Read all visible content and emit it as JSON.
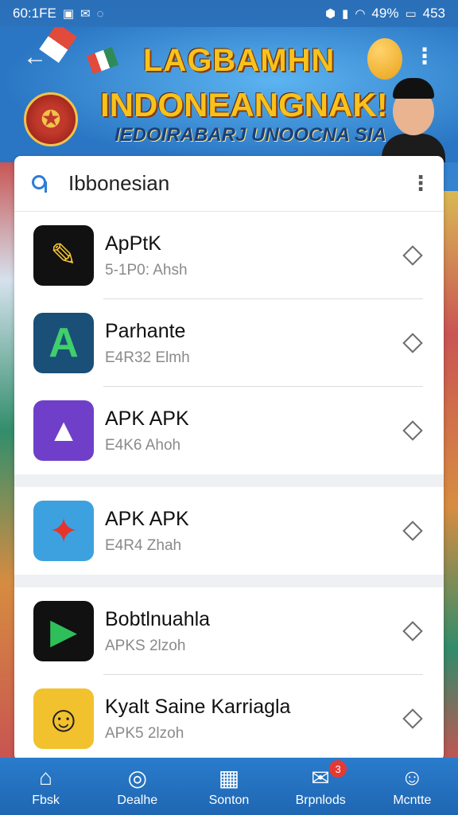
{
  "status_bar": {
    "time": "60:1FE",
    "battery": "49%",
    "network": "453"
  },
  "banner": {
    "title_line1": "LAGBAMHN",
    "title_line2": "INDONEANGNAK!",
    "subtitle": "IEDOIRABARJ UNOOCNA SIA"
  },
  "search": {
    "value": "Ibbonesian"
  },
  "apps": [
    {
      "title": "ApPtK",
      "subtitle": "5-1P0: Ahsh",
      "icon_color": "#f2c12e",
      "icon_bg": "#111111",
      "icon_glyph": "✎"
    },
    {
      "title": "Parhante",
      "subtitle": "E4R32 Elmh",
      "icon_color": "#3fcf6b",
      "icon_bg": "#1a4f78",
      "icon_glyph": "A"
    },
    {
      "title": "APK APK",
      "subtitle": "E4K6 Ahoh",
      "icon_color": "#ffffff",
      "icon_bg": "#6f3fc9",
      "icon_glyph": "▲"
    },
    {
      "title": "APK APK",
      "subtitle": "E4R4 Zhah",
      "icon_color": "#e8332a",
      "icon_bg": "#3da1e0",
      "icon_glyph": "✦"
    },
    {
      "title": "Bobtlnuahla",
      "subtitle": "APKS 2lzoh",
      "icon_color": "#2fbf5a",
      "icon_bg": "#111111",
      "icon_glyph": "▶"
    },
    {
      "title": "Kyalt Saine Karriagla",
      "subtitle": "APK5 2lzoh",
      "icon_color": "#1f1f1f",
      "icon_bg": "#f2c12e",
      "icon_glyph": "☺"
    }
  ],
  "nav": [
    {
      "label": "Fbsk",
      "icon": "home-icon",
      "glyph": "⌂"
    },
    {
      "label": "Dealhe",
      "icon": "camera-icon",
      "glyph": "◎"
    },
    {
      "label": "Sonton",
      "icon": "grid-icon",
      "glyph": "▦"
    },
    {
      "label": "Brpnlods",
      "icon": "download-icon",
      "glyph": "✉",
      "badge": "3"
    },
    {
      "label": "Mcntte",
      "icon": "profile-icon",
      "glyph": "☺"
    }
  ],
  "colors": {
    "accent": "#2b7ed6",
    "banner_title": "#f7c21c",
    "badge": "#e53935"
  }
}
